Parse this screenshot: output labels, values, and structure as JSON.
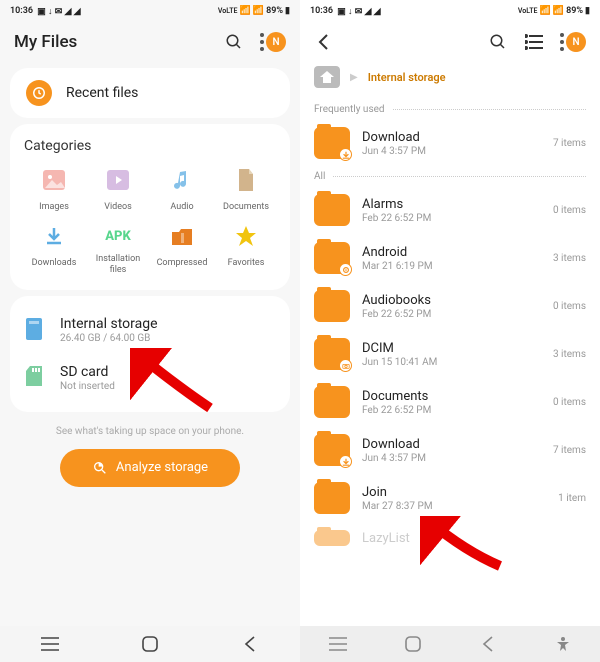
{
  "statusbar": {
    "time": "10:36",
    "battery": "89%"
  },
  "left": {
    "title": "My Files",
    "avatar_initial": "N",
    "recent_label": "Recent files",
    "categories_label": "Categories",
    "categories": [
      {
        "label": "Images"
      },
      {
        "label": "Videos"
      },
      {
        "label": "Audio"
      },
      {
        "label": "Documents"
      },
      {
        "label": "Downloads"
      },
      {
        "label": "Installation files"
      },
      {
        "label": "Compressed"
      },
      {
        "label": "Favorites"
      }
    ],
    "storage_internal": {
      "name": "Internal storage",
      "sub": "26.40 GB / 64.00 GB"
    },
    "storage_sd": {
      "name": "SD card",
      "sub": "Not inserted"
    },
    "hint": "See what's taking up space on your phone.",
    "analyze_label": "Analyze storage"
  },
  "right": {
    "avatar_initial": "N",
    "breadcrumb_current": "Internal storage",
    "section_freq": "Frequently used",
    "section_all": "All",
    "freq": [
      {
        "name": "Download",
        "sub": "Jun 4 3:57 PM",
        "count": "7 items",
        "badge": "download"
      }
    ],
    "all": [
      {
        "name": "Alarms",
        "sub": "Feb 22 6:52 PM",
        "count": "0 items"
      },
      {
        "name": "Android",
        "sub": "Mar 21 6:19 PM",
        "count": "3 items",
        "badge": "gear"
      },
      {
        "name": "Audiobooks",
        "sub": "Feb 22 6:52 PM",
        "count": "0 items"
      },
      {
        "name": "DCIM",
        "sub": "Jun 15 10:41 AM",
        "count": "3 items",
        "badge": "camera"
      },
      {
        "name": "Documents",
        "sub": "Feb 22 6:52 PM",
        "count": "0 items"
      },
      {
        "name": "Download",
        "sub": "Jun 4 3:57 PM",
        "count": "7 items",
        "badge": "download"
      },
      {
        "name": "Join",
        "sub": "Mar 27 8:37 PM",
        "count": "1 item"
      },
      {
        "name": "LazyList",
        "sub": "",
        "count": ""
      }
    ]
  }
}
